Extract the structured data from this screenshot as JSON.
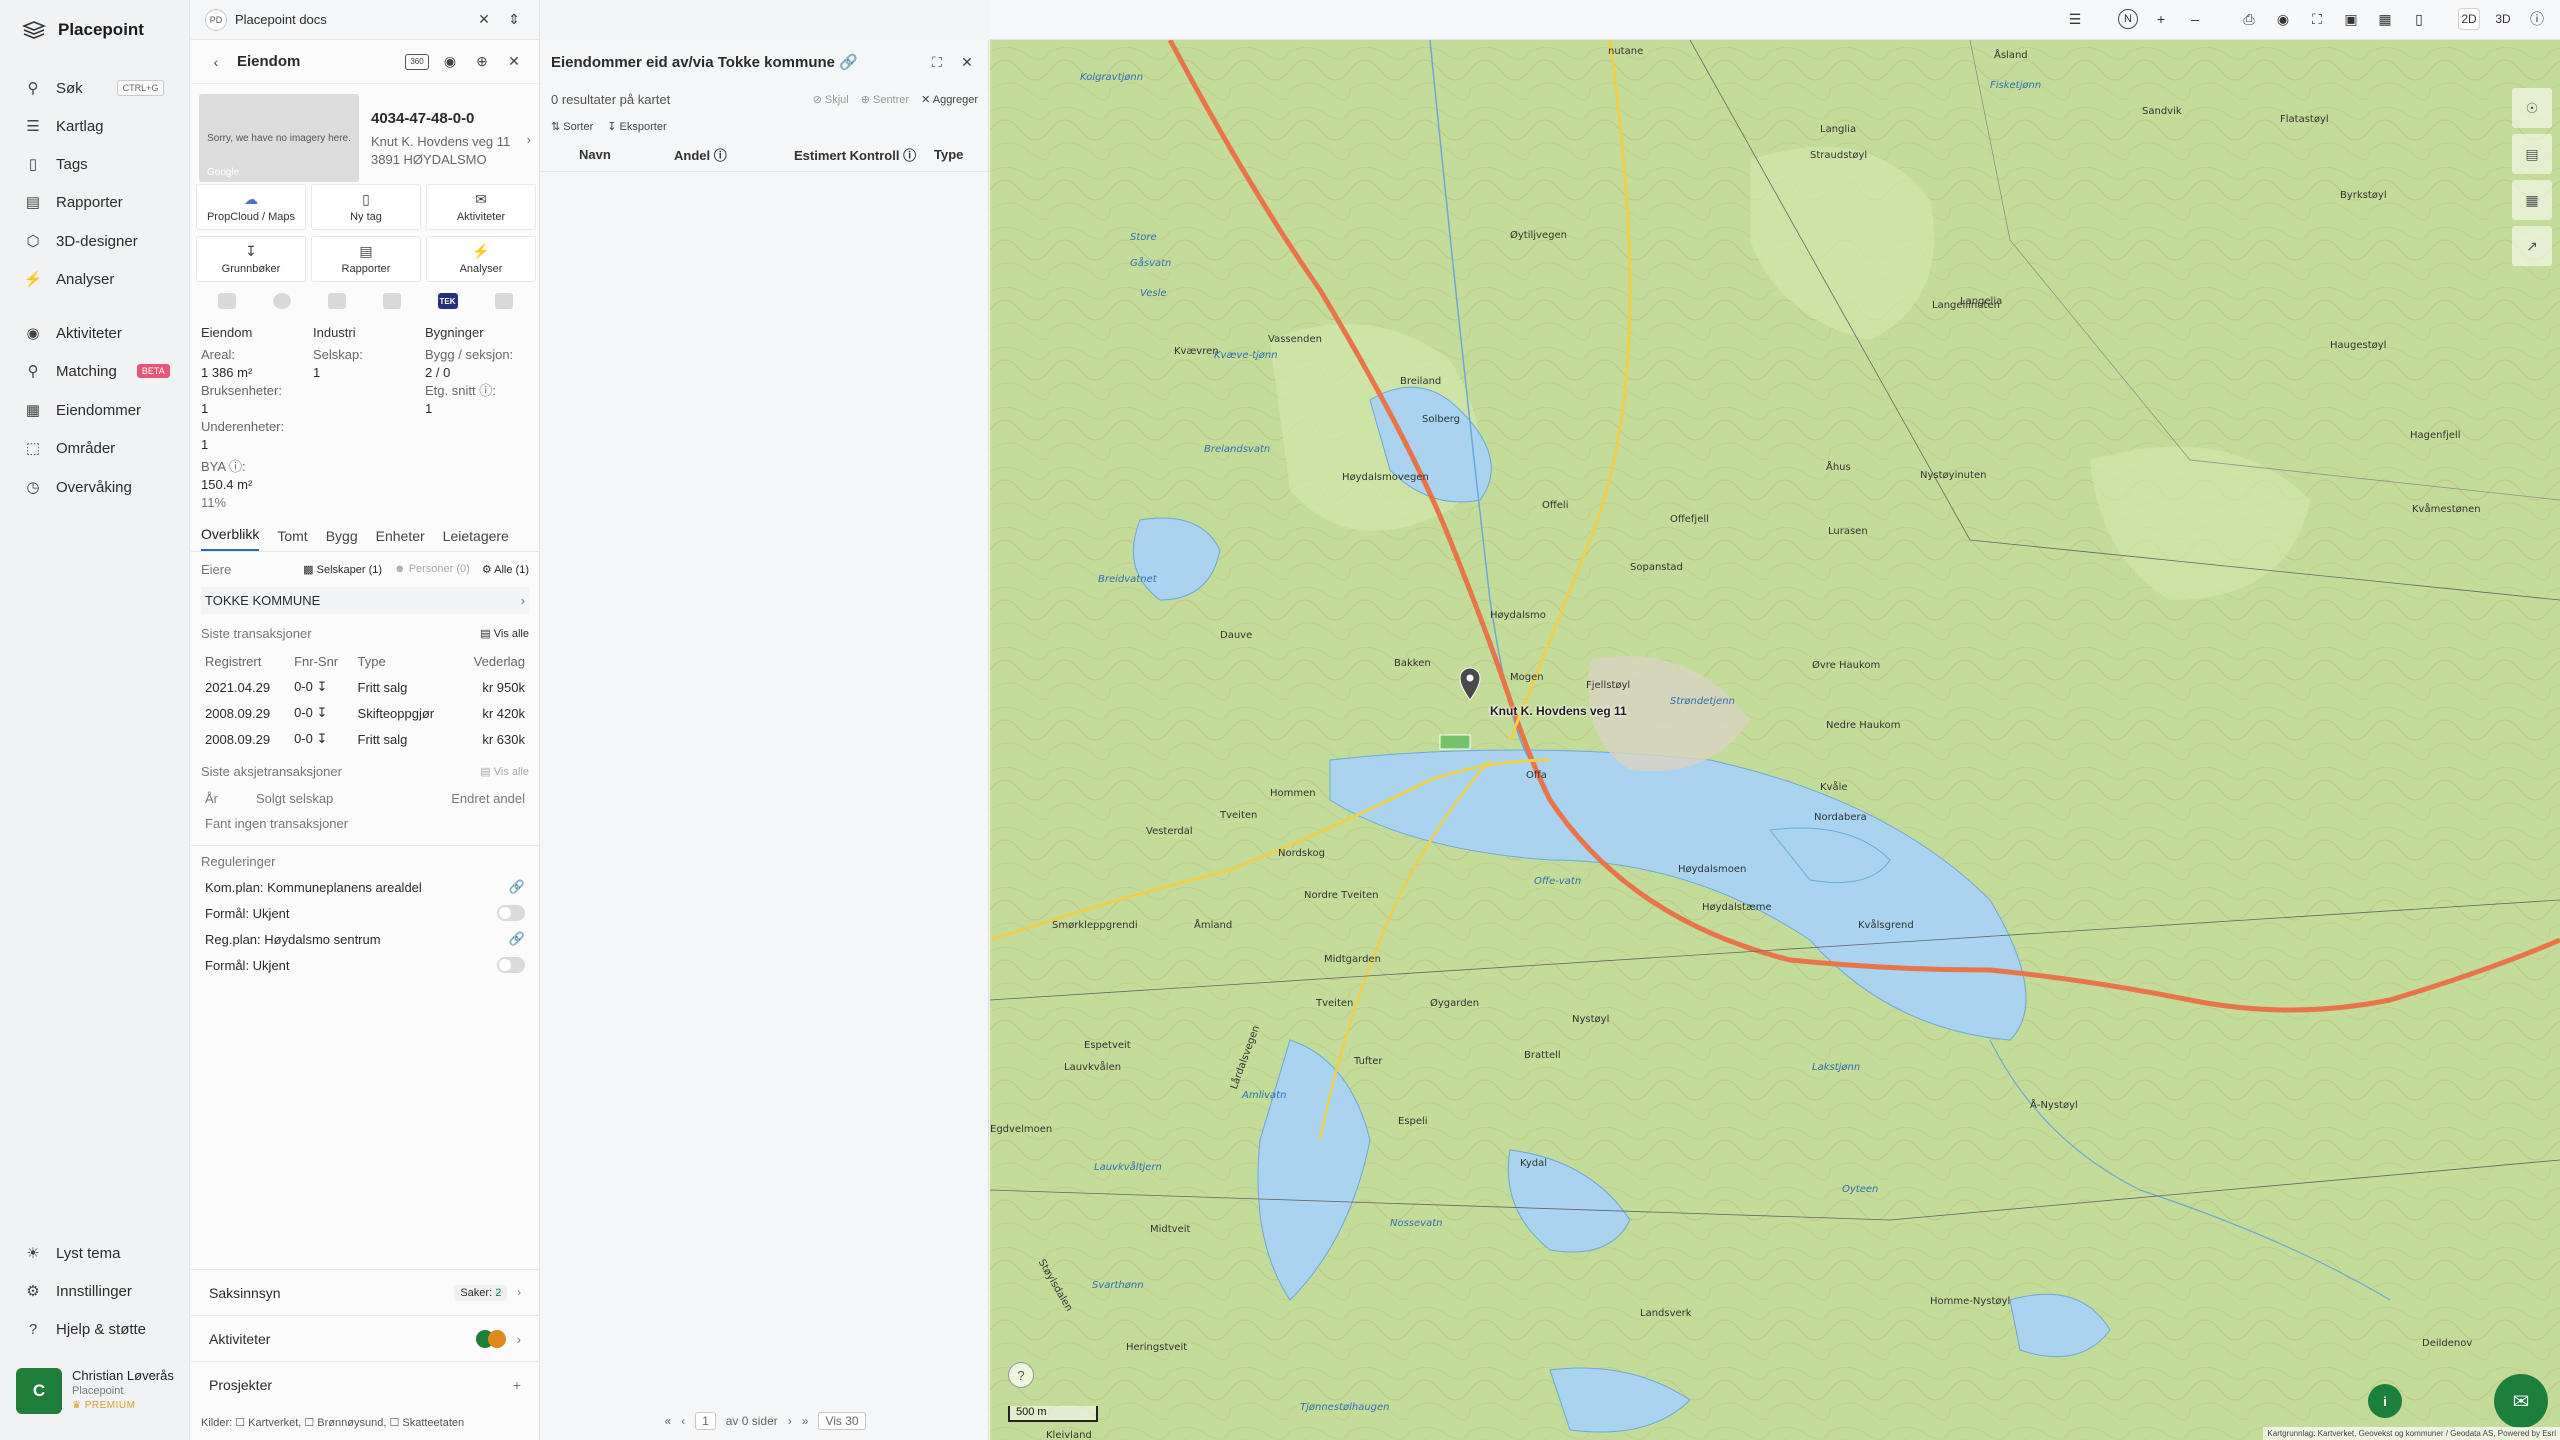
{
  "app": {
    "name": "Placepoint"
  },
  "nav": {
    "items": [
      {
        "label": "Søk",
        "icon": "search-icon",
        "shortcut": "CTRL+G"
      },
      {
        "label": "Kartlag",
        "icon": "layers-icon"
      },
      {
        "label": "Tags",
        "icon": "bookmark-icon"
      },
      {
        "label": "Rapporter",
        "icon": "chart-icon"
      },
      {
        "label": "3D-designer",
        "icon": "cube-icon"
      },
      {
        "label": "Analyser",
        "icon": "bolt-icon"
      },
      {
        "label": "Aktiviteter",
        "icon": "activity-icon"
      },
      {
        "label": "Matching",
        "icon": "match-icon",
        "badge": "BETA"
      },
      {
        "label": "Eiendommer",
        "icon": "building-icon"
      },
      {
        "label": "Områder",
        "icon": "area-icon"
      },
      {
        "label": "Overvåking",
        "icon": "monitor-icon"
      }
    ],
    "bottom": [
      {
        "label": "Lyst tema",
        "icon": "sun-icon"
      },
      {
        "label": "Innstillinger",
        "icon": "gear-icon"
      },
      {
        "label": "Hjelp & støtte",
        "icon": "help-icon"
      }
    ],
    "user": {
      "initial": "C",
      "name": "Christian Løverås",
      "org": "Placepoint",
      "plan": "PREMIUM"
    }
  },
  "doc_tab": {
    "badge": "PD",
    "title": "Placepoint docs"
  },
  "property": {
    "header": "Eiendom",
    "header_badge": "360",
    "thumb_text": "Sorry, we have no imagery here.",
    "thumb_brand": "Google",
    "id": "4034-47-48-0-0",
    "address_line1": "Knut K. Hovdens veg 11",
    "address_line2": "3891 HØYDALSMO",
    "actions": [
      {
        "label": "PropCloud / Maps",
        "icon": "cloud-icon"
      },
      {
        "label": "Ny tag",
        "icon": "bookmark-icon"
      },
      {
        "label": "Aktiviteter",
        "icon": "chat-icon"
      },
      {
        "label": "Grunnbøker",
        "icon": "download-icon"
      },
      {
        "label": "Rapporter",
        "icon": "chart-icon"
      },
      {
        "label": "Analyser",
        "icon": "bolt-icon"
      }
    ],
    "tek_label": "TEK",
    "facts": {
      "col1_head": "Eiendom",
      "areal_label": "Areal:",
      "areal_value": "1 386 m²",
      "bruks_label": "Bruksenheter:",
      "bruks_value": "1",
      "under_label": "Underenheter:",
      "under_value": "1",
      "bya_label": "BYA ⓘ:",
      "bya_value": "150.4 m²",
      "bya_pct": "11%",
      "col2_head": "Industri",
      "selskap_label": "Selskap:",
      "selskap_value": "1",
      "col3_head": "Bygninger",
      "bygg_label": "Bygg / seksjon:",
      "bygg_value": "2 / 0",
      "etg_label": "Etg. snitt ⓘ:",
      "etg_value": "1"
    },
    "tabs": [
      "Overblikk",
      "Tomt",
      "Bygg",
      "Enheter",
      "Leietagere"
    ],
    "owners": {
      "label": "Eiere",
      "filter_companies": "Selskaper (1)",
      "filter_persons": "Personer (0)",
      "filter_all": "Alle (1)",
      "owner_name": "TOKKE KOMMUNE"
    },
    "transactions": {
      "label": "Siste transaksjoner",
      "show_all": "Vis alle",
      "headers": [
        "Registrert",
        "Fnr-Snr",
        "Type",
        "Vederlag"
      ],
      "rows": [
        {
          "date": "2021.04.29",
          "fnr": "0-0",
          "type": "Fritt salg",
          "price": "kr 950k"
        },
        {
          "date": "2008.09.29",
          "fnr": "0-0",
          "type": "Skifteoppgjør",
          "price": "kr 420k"
        },
        {
          "date": "2008.09.29",
          "fnr": "0-0",
          "type": "Fritt salg",
          "price": "kr 630k"
        }
      ]
    },
    "share_tx": {
      "label": "Siste aksjetransaksjoner",
      "show_all": "Vis alle",
      "headers": [
        "År",
        "Solgt selskap",
        "Endret andel"
      ],
      "empty": "Fant ingen transaksjoner"
    },
    "regulations": {
      "label": "Reguleringer",
      "items": [
        {
          "text": "Kom.plan: Kommuneplanens arealdel",
          "kind": "link"
        },
        {
          "text": "Formål: Ukjent",
          "kind": "toggle"
        },
        {
          "text": "Reg.plan: Høydalsmo sentrum",
          "kind": "link"
        },
        {
          "text": "Formål: Ukjent",
          "kind": "toggle"
        }
      ]
    },
    "bottom": {
      "saksinnsyn": "Saksinnsyn",
      "saker_label": "Saker:",
      "saker_count": "2",
      "aktiviteter": "Aktiviteter",
      "prosjekter": "Prosjekter"
    },
    "sources": "Kilder: ☐ Kartverket, ☐ Brønnøysund, ☐ Skatteetaten"
  },
  "owner_panel": {
    "title": "Eiendommer eid av/via Tokke kommune",
    "result_text": "0 resultater på kartet",
    "hide": "Skjul",
    "center": "Sentrer",
    "aggregate": "Aggreger",
    "sort": "Sorter",
    "export": "Eksporter",
    "columns": [
      "Navn",
      "Andel ⓘ",
      "Estimert Kontroll ⓘ",
      "Type"
    ],
    "pager": {
      "page": "1",
      "of_text": "av 0 sider",
      "per_page": "Vis 30"
    }
  },
  "map": {
    "toolbar": [
      "N",
      "+",
      "–"
    ],
    "mode_2d": "2D",
    "mode_3d": "3D",
    "marker_label": "Knut K. Hovdens veg 11",
    "scale": "500 m",
    "attribution": "Kartgrunnlag: Kartverket, Geovekst og kommuner / Geodata AS, Powered by Esri",
    "colors": {
      "terrain": "#c4dc9a",
      "water": "#a9d3ee",
      "road_main": "#e8744a",
      "contour": "#c3a87a",
      "accent": "#1c7f3d"
    },
    "labels": [
      "nutane",
      "Åsland",
      "Kolgravtjønn",
      "Langlia",
      "Fisketjønn",
      "Sandvik",
      "Flatastøyl",
      "Straudstøyl",
      "Store",
      "Gåsvatn",
      "Vesle",
      "Kvævren",
      "Kvæve-tjønn",
      "Vassenden",
      "Langelia",
      "Breiland",
      "Solberg",
      "Byrkstøyl",
      "Haugestøyl",
      "Åhus",
      "Brelandsvatn",
      "Nystøyinuten",
      "Øytiljvegen",
      "Langeliinuten",
      "Hagenfjell",
      "Høydalsmovegen",
      "Offeli",
      "Offefjell",
      "Lurasen",
      "Kvåmestønen",
      "Dauve",
      "Høydalsmo",
      "Bakken",
      "Mogen",
      "Fjellstøyl",
      "Sopanstad",
      "Øvre Haukom",
      "Breidvatnet",
      "Strøndetjenn",
      "Nedre Haukom",
      "Tveiten",
      "Hommen",
      "Offa",
      "Kvåle",
      "Nordabera",
      "Vesterdal",
      "Nordskog",
      "Nordre Tveiten",
      "Offe-vatn",
      "Høydalsmoen",
      "Høydalstæme",
      "Kvålsgrend",
      "Åmland",
      "Smørkleppgrendi",
      "Midtgarden",
      "Tveiten",
      "Øygarden",
      "Espetveit",
      "Lauvkvålen",
      "Amlivatn",
      "Brattell",
      "Tufter",
      "Nystøyl",
      "Lakstjønn",
      "Espeli",
      "Å-Nystøyl",
      "Lauvkvåltjern",
      "Kydal",
      "Oyteen",
      "Midtveit",
      "Nossevatn",
      "Landsverk",
      "Homme-Nystøyl",
      "Heringstveit",
      "Svarthønn",
      "Deildenov",
      "Tjønnestølhaugen",
      "Støylsdalen",
      "Egdvelmoen",
      "Lårdalsvegen",
      "Kleivland"
    ]
  }
}
